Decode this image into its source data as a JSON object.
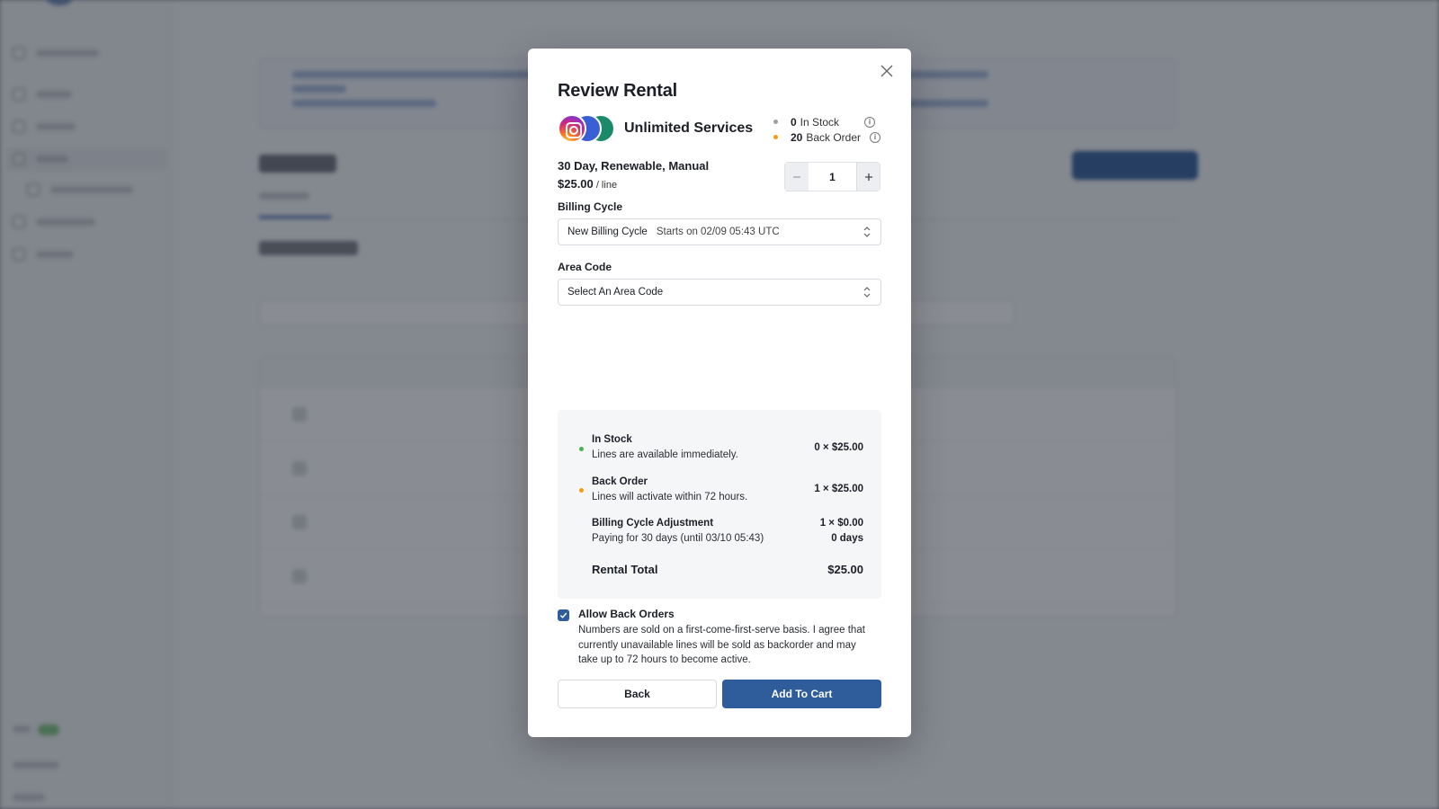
{
  "modal": {
    "title": "Review Rental",
    "service_name": "Unlimited Services",
    "stock": {
      "in_stock_count": "0",
      "in_stock_label": "In Stock",
      "back_order_count": "20",
      "back_order_label": "Back Order"
    },
    "plan": {
      "name": "30 Day, Renewable, Manual",
      "price": "$25.00",
      "price_unit": " / line"
    },
    "quantity": "1",
    "billing_cycle": {
      "label": "Billing Cycle",
      "value": "New Billing Cycle",
      "detail": "Starts on 02/09 05:43 UTC"
    },
    "area_code": {
      "label": "Area Code",
      "value": "Select An Area Code"
    },
    "summary": {
      "in_stock": {
        "title": "In Stock",
        "desc": "Lines are available immediately.",
        "qty": "0 ×  $25.00"
      },
      "back_order": {
        "title": "Back Order",
        "desc": "Lines will activate within 72 hours.",
        "qty": "1 ×  $25.00"
      },
      "adjustment": {
        "title": "Billing Cycle Adjustment",
        "desc": "Paying for 30 days (until 03/10 05:43)",
        "qty": "1 ×  $0.00",
        "days": "0 days"
      },
      "total_label": "Rental Total",
      "total_value": "$25.00"
    },
    "back_orders": {
      "label": "Allow Back Orders",
      "checked": true,
      "text": "Numbers are sold on a first-come-first-serve basis. I agree that currently unavailable lines will be sold as backorder and may take up to 72 hours to become active."
    },
    "buttons": {
      "back": "Back",
      "add_to_cart": "Add To Cart"
    }
  },
  "icons": {
    "close": "close-icon",
    "info": "info-icon",
    "chevron": "chevron-up-down-icon",
    "check": "check-icon",
    "services": [
      "instagram-icon",
      "facebook-icon",
      "whatsapp-icon"
    ]
  },
  "colors": {
    "primary": "#2f5c9b",
    "in_stock_dot": "#4caf50",
    "back_order_dot": "#f39c12",
    "neutral_dot": "#9aa0a6"
  }
}
